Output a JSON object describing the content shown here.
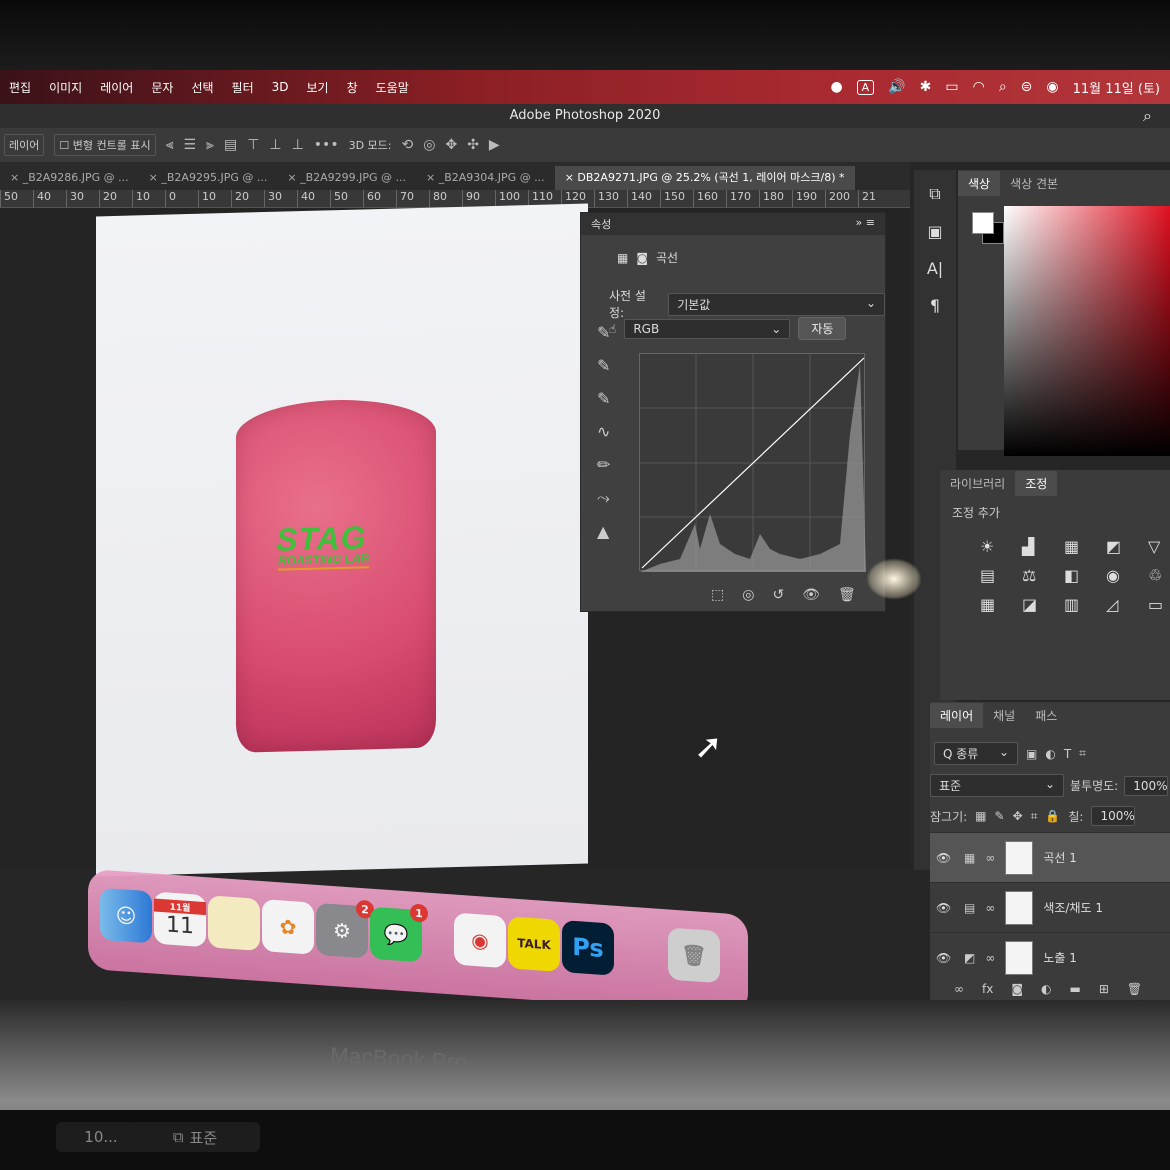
{
  "menubar": {
    "items": [
      "편집",
      "이미지",
      "레이어",
      "문자",
      "선택",
      "필터",
      "3D",
      "보기",
      "창",
      "도움말"
    ],
    "input_badge": "A",
    "datetime": "11월 11일 (토)"
  },
  "app": {
    "title": "Adobe Photoshop 2020"
  },
  "options_bar": {
    "tool_select": "레이어",
    "show_transform_label": "변형 컨트롤 표시",
    "mode_3d_label": "3D 모드:"
  },
  "tabs": [
    {
      "label": "_B2A9286.JPG @ ..."
    },
    {
      "label": "_B2A9295.JPG @ ..."
    },
    {
      "label": "_B2A9299.JPG @ ..."
    },
    {
      "label": "_B2A9304.JPG @ ..."
    },
    {
      "label": "DB2A9271.JPG @ 25.2% (곡선 1, 레이어 마스크/8) *",
      "active": true
    }
  ],
  "ruler": [
    "50",
    "40",
    "30",
    "20",
    "10",
    "0",
    "10",
    "20",
    "30",
    "40",
    "50",
    "60",
    "70",
    "80",
    "90",
    "100",
    "110",
    "120",
    "130",
    "140",
    "150",
    "160",
    "170",
    "180",
    "190",
    "200",
    "21"
  ],
  "document": {
    "cup_logo": "STAG",
    "cup_sub": "ROASTING LAB"
  },
  "properties": {
    "tab": "속성",
    "title": "곡선",
    "preset_label": "사전 설정:",
    "preset_value": "기본값",
    "channel": "RGB",
    "auto_button": "자동"
  },
  "color_panel": {
    "tabs": [
      "색상",
      "색상 견본"
    ]
  },
  "adjustments": {
    "tabs": [
      "라이브러리",
      "조정"
    ],
    "add_label": "조정 추가"
  },
  "layers": {
    "tabs": [
      "레이어",
      "채널",
      "패스"
    ],
    "filter": "Q 종류",
    "blend_mode": "표준",
    "opacity_label": "불투명도:",
    "opacity": "100%",
    "lock_label": "잠그기:",
    "fill_label": "칠:",
    "fill": "100%",
    "items": [
      {
        "name": "곡선 1",
        "selected": true
      },
      {
        "name": "색조/채도 1"
      },
      {
        "name": "노출 1"
      }
    ]
  },
  "dock": {
    "calendar_month": "11월",
    "calendar_day": "11",
    "settings_badge": "2",
    "messages_badge": "1",
    "talk_label": "TALK",
    "ps_label": "Ps"
  },
  "laptop": {
    "brand": "MacBook Pro",
    "touchbar_left": "10...",
    "touchbar_mode": "표준"
  }
}
